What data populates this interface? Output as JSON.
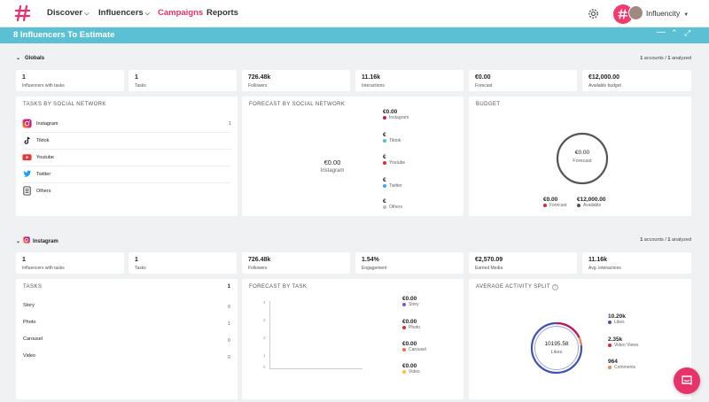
{
  "nav": {
    "discover": "Discover",
    "influencers": "Influencers",
    "campaigns": "Campaigns",
    "reports": "Reports",
    "account": "Influencity"
  },
  "titlebar": {
    "title": "8 Influencers To Estimate"
  },
  "globals": {
    "header": "Globals",
    "accounts_num": "1",
    "accounts_mid": " accounts / ",
    "analyzed_num": "1",
    "analyzed_lbl": " analyzed",
    "stats": [
      {
        "value": "1",
        "label": "Influencers with tasks"
      },
      {
        "value": "1",
        "label": "Tasks"
      },
      {
        "value": "726.48k",
        "label": "Followers"
      },
      {
        "value": "11.16k",
        "label": "Interactions"
      },
      {
        "value": "€0.00",
        "label": "Forecast"
      },
      {
        "value": "€12,000.00",
        "label": "Available budget"
      }
    ],
    "tasks_by_network": {
      "title": "TASKS BY SOCIAL NETWORK",
      "rows": [
        {
          "name": "Instagram",
          "count": "1"
        },
        {
          "name": "Tiktok",
          "count": ""
        },
        {
          "name": "Youtube",
          "count": ""
        },
        {
          "name": "Twitter",
          "count": ""
        },
        {
          "name": "Others",
          "count": ""
        }
      ]
    },
    "forecast_by_network": {
      "title": "FORECAST BY SOCIAL NETWORK",
      "center_value": "€0.00",
      "center_label": "Instagram",
      "legend": [
        {
          "value": "€0.00",
          "label": "Instagram",
          "color": "#c2185b"
        },
        {
          "value": "€",
          "label": "Tiktok",
          "color": "#4dc3c7"
        },
        {
          "value": "€",
          "label": "Youtube",
          "color": "#d32f2f"
        },
        {
          "value": "€",
          "label": "Twitter",
          "color": "#42a5f5"
        },
        {
          "value": "€",
          "label": "Others",
          "color": "#bdbdbd"
        }
      ]
    },
    "budget": {
      "title": "BUDGET",
      "center_value": "€0.00",
      "center_label": "Forecast",
      "legend": [
        {
          "value": "€0.00",
          "label": "Forecast",
          "color": "#d32f2f"
        },
        {
          "value": "€12,000.00",
          "label": "Available",
          "color": "#555555"
        }
      ]
    }
  },
  "instagram": {
    "header": "Instagram",
    "accounts_num": "1",
    "accounts_mid": " accounts / ",
    "analyzed_num": "1",
    "analyzed_lbl": " analyzed",
    "stats": [
      {
        "value": "1",
        "label": "Influencers with tasks"
      },
      {
        "value": "1",
        "label": "Tasks"
      },
      {
        "value": "726.48k",
        "label": "Followers"
      },
      {
        "value": "1.54%",
        "label": "Engagement"
      },
      {
        "value": "€2,570.09",
        "label": "Earned Media"
      },
      {
        "value": "11.16k",
        "label": "Avg. interactions"
      }
    ],
    "tasks": {
      "title": "TASKS",
      "total": "1",
      "rows": [
        {
          "name": "Story",
          "count": "0"
        },
        {
          "name": "Photo",
          "count": "1"
        },
        {
          "name": "Carousel",
          "count": "0"
        },
        {
          "name": "Video",
          "count": "0"
        }
      ]
    },
    "forecast_by_task": {
      "title": "FORECAST BY TASK",
      "yticks": [
        "4",
        "3",
        "2",
        "1",
        "0"
      ],
      "legend": [
        {
          "value": "€0.00",
          "label": "Story",
          "color": "#7e57c2"
        },
        {
          "value": "€0.00",
          "label": "Photo",
          "color": "#d32f2f"
        },
        {
          "value": "€0.00",
          "label": "Carousel",
          "color": "#ef6c4a"
        },
        {
          "value": "€0.00",
          "label": "Video",
          "color": "#fbc02d"
        }
      ]
    },
    "activity_split": {
      "title": "AVERAGE ACTIVITY SPLIT",
      "center_value": "10195.58",
      "center_label": "Likes",
      "legend": [
        {
          "value": "10.20k",
          "label": "Likes",
          "color": "#3f51b5"
        },
        {
          "value": "2.35k",
          "label": "Video Views",
          "color": "#d32f2f"
        },
        {
          "value": "964",
          "label": "Comments",
          "color": "#ef8a4a"
        }
      ]
    }
  }
}
